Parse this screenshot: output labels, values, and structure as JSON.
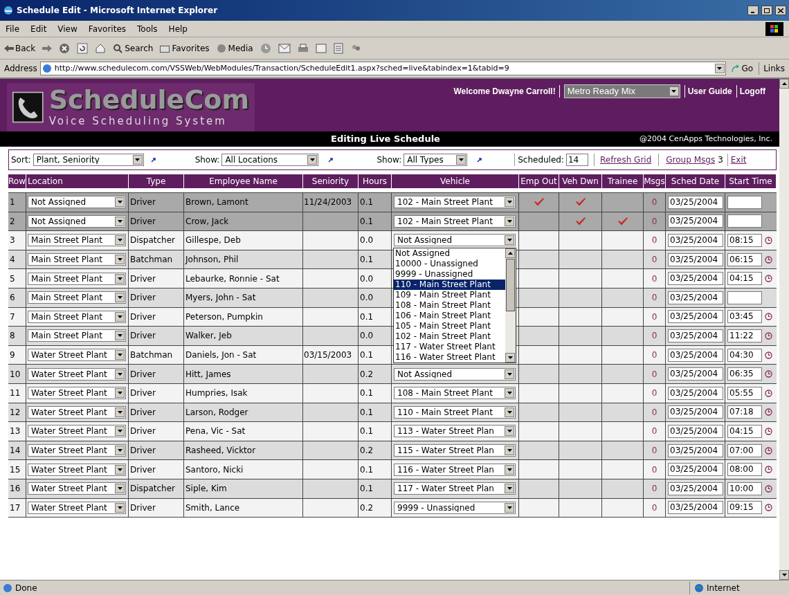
{
  "window": {
    "title": "Schedule Edit - Microsoft Internet Explorer"
  },
  "menu": [
    "File",
    "Edit",
    "View",
    "Favorites",
    "Tools",
    "Help"
  ],
  "toolbar": {
    "back": "Back",
    "search": "Search",
    "favorites": "Favorites",
    "media": "Media"
  },
  "address": {
    "label": "Address",
    "url": "http://www.schedulecom.com/VSSWeb/WebModules/Transaction/ScheduleEdit1.aspx?sched=live&tabindex=1&tabid=9",
    "go": "Go",
    "links": "Links"
  },
  "header": {
    "logo_title": "ScheduleCom",
    "logo_subtitle": "Voice Scheduling System",
    "welcome": "Welcome Dwayne Carroll!",
    "company": "Metro Ready Mix",
    "links": [
      "User Guide",
      "Logoff"
    ]
  },
  "banner": {
    "title": "Editing Live Schedule",
    "copyright": "@2004 CenApps Technologies, Inc."
  },
  "filters": {
    "sort_label": "Sort:",
    "sort_value": "Plant, Seniority",
    "show_label": "Show:",
    "show_value": "All Locations",
    "type_label": "Show:",
    "type_value": "All Types",
    "scheduled_label": "Scheduled:",
    "scheduled_value": "14",
    "refresh": "Refresh Grid",
    "group_msgs": "Group Msgs",
    "group_count": "3",
    "exit": "Exit"
  },
  "table": {
    "columns": [
      "Row",
      "Location",
      "Type",
      "Employee Name",
      "Seniority",
      "Hours",
      "Vehicle",
      "Emp Out",
      "Veh Dwn",
      "Trainee",
      "Msgs",
      "Sched Date",
      "Start Time"
    ],
    "rows": [
      {
        "row": "1",
        "location": "Not Assigned",
        "type": "Driver",
        "name": "Brown, Lamont",
        "seniority": "11/24/2003",
        "hours": "0.1",
        "vehicle": "102 - Main Street Plant",
        "emp_out": true,
        "veh_down": true,
        "trainee": false,
        "msgs": "0",
        "date": "03/25/2004",
        "flagged": true
      },
      {
        "row": "2",
        "location": "Not Assigned",
        "type": "Driver",
        "name": "Crow, Jack",
        "hours": "0.1",
        "vehicle": "102 - Main Street Plant",
        "emp_out": false,
        "veh_down": true,
        "trainee": true,
        "msgs": "0",
        "date": "03/25/2004",
        "flagged": true
      },
      {
        "row": "3",
        "location": "Main Street Plant",
        "type": "Dispatcher",
        "name": "Gillespe, Deb",
        "hours": "0.0",
        "vehicle": "Not Assigned",
        "emp_out": false,
        "veh_down": false,
        "trainee": false,
        "msgs": "0",
        "date": "03/25/2004",
        "time": "08:15",
        "flagged": false,
        "vehicle_options": [
          {
            "label": "Not Assigned",
            "selected": false
          },
          {
            "label": "10000 - Unassigned",
            "selected": false
          },
          {
            "label": "9999 - Unassigned",
            "selected": false
          },
          {
            "label": "110 - Main Street Plant",
            "selected": true
          },
          {
            "label": "109 - Main Street Plant",
            "selected": false
          },
          {
            "label": "108 - Main Street Plant",
            "selected": false
          },
          {
            "label": "106 - Main Street Plant",
            "selected": false
          },
          {
            "label": "105 - Main Street Plant",
            "selected": false
          },
          {
            "label": "102 - Main Street Plant",
            "selected": false
          },
          {
            "label": "117 - Water Street Plant",
            "selected": false
          },
          {
            "label": "116 - Water Street Plant",
            "selected": false
          }
        ]
      },
      {
        "row": "4",
        "location": "Main Street Plant",
        "type": "Batchman",
        "name": "Johnson, Phil",
        "hours": "0.1",
        "emp_out": false,
        "veh_down": false,
        "trainee": false,
        "msgs": "0",
        "date": "03/25/2004",
        "time": "06:15",
        "flagged": false
      },
      {
        "row": "5",
        "location": "Main Street Plant",
        "type": "Driver",
        "name": "Lebaurke, Ronnie - Sat",
        "hours": "0.0",
        "emp_out": false,
        "veh_down": false,
        "trainee": false,
        "msgs": "0",
        "date": "03/25/2004",
        "time": "04:15",
        "flagged": false
      },
      {
        "row": "6",
        "location": "Main Street Plant",
        "type": "Driver",
        "name": "Myers, John - Sat",
        "hours": "0.0",
        "emp_out": false,
        "veh_down": false,
        "trainee": false,
        "msgs": "0",
        "date": "03/25/2004",
        "flagged": false
      },
      {
        "row": "7",
        "location": "Main Street Plant",
        "type": "Driver",
        "name": "Peterson, Pumpkin",
        "hours": "0.1",
        "emp_out": false,
        "veh_down": false,
        "trainee": false,
        "msgs": "0",
        "date": "03/25/2004",
        "time": "03:45",
        "flagged": false
      },
      {
        "row": "8",
        "location": "Main Street Plant",
        "type": "Driver",
        "name": "Walker, Jeb",
        "hours": "0.0",
        "emp_out": false,
        "veh_down": false,
        "trainee": false,
        "msgs": "0",
        "date": "03/25/2004",
        "time": "11:22",
        "flagged": false
      },
      {
        "row": "9",
        "location": "Water Street Plant",
        "type": "Batchman",
        "name": "Daniels, Jon - Sat",
        "seniority": "03/15/2003",
        "hours": "0.1",
        "emp_out": false,
        "veh_down": false,
        "trainee": false,
        "msgs": "0",
        "date": "03/25/2004",
        "time": "04:30",
        "flagged": false
      },
      {
        "row": "10",
        "location": "Water Street Plant",
        "type": "Driver",
        "name": "Hitt, James",
        "hours": "0.2",
        "vehicle": "Not Assigned",
        "emp_out": false,
        "veh_down": false,
        "trainee": false,
        "msgs": "0",
        "date": "03/25/2004",
        "time": "06:35",
        "flagged": false
      },
      {
        "row": "11",
        "location": "Water Street Plant",
        "type": "Driver",
        "name": "Humpries, Isak",
        "hours": "0.1",
        "vehicle": "108 - Main Street Plant",
        "emp_out": false,
        "veh_down": false,
        "trainee": false,
        "msgs": "0",
        "date": "03/25/2004",
        "time": "05:55",
        "flagged": false
      },
      {
        "row": "12",
        "location": "Water Street Plant",
        "type": "Driver",
        "name": "Larson, Rodger",
        "hours": "0.1",
        "vehicle": "110 - Main Street Plant",
        "emp_out": false,
        "veh_down": false,
        "trainee": false,
        "msgs": "0",
        "date": "03/25/2004",
        "time": "07:18",
        "flagged": false
      },
      {
        "row": "13",
        "location": "Water Street Plant",
        "type": "Driver",
        "name": "Pena, Vic - Sat",
        "hours": "0.1",
        "vehicle": "113 - Water Street Plan",
        "emp_out": false,
        "veh_down": false,
        "trainee": false,
        "msgs": "0",
        "date": "03/25/2004",
        "time": "04:15",
        "flagged": false
      },
      {
        "row": "14",
        "location": "Water Street Plant",
        "type": "Driver",
        "name": "Rasheed, Vicktor",
        "hours": "0.2",
        "vehicle": "115 - Water Street Plan",
        "emp_out": false,
        "veh_down": false,
        "trainee": false,
        "msgs": "0",
        "date": "03/25/2004",
        "time": "07:00",
        "flagged": false
      },
      {
        "row": "15",
        "location": "Water Street Plant",
        "type": "Driver",
        "name": "Santoro, Nicki",
        "hours": "0.1",
        "vehicle": "116 - Water Street Plan",
        "emp_out": false,
        "veh_down": false,
        "trainee": false,
        "msgs": "0",
        "date": "03/25/2004",
        "time": "08:00",
        "flagged": false
      },
      {
        "row": "16",
        "location": "Water Street Plant",
        "type": "Dispatcher",
        "name": "Siple, Kim",
        "hours": "0.1",
        "vehicle": "117 - Water Street Plan",
        "emp_out": false,
        "veh_down": false,
        "trainee": false,
        "msgs": "0",
        "date": "03/25/2004",
        "time": "10:00",
        "flagged": false
      },
      {
        "row": "17",
        "location": "Water Street Plant",
        "type": "Driver",
        "name": "Smith, Lance",
        "hours": "0.2",
        "vehicle": "9999 - Unassigned",
        "emp_out": false,
        "veh_down": false,
        "trainee": false,
        "msgs": "0",
        "date": "03/25/2004",
        "time": "09:15",
        "flagged": false
      }
    ]
  },
  "status_bar": {
    "text": "Done",
    "zone": "Internet"
  }
}
